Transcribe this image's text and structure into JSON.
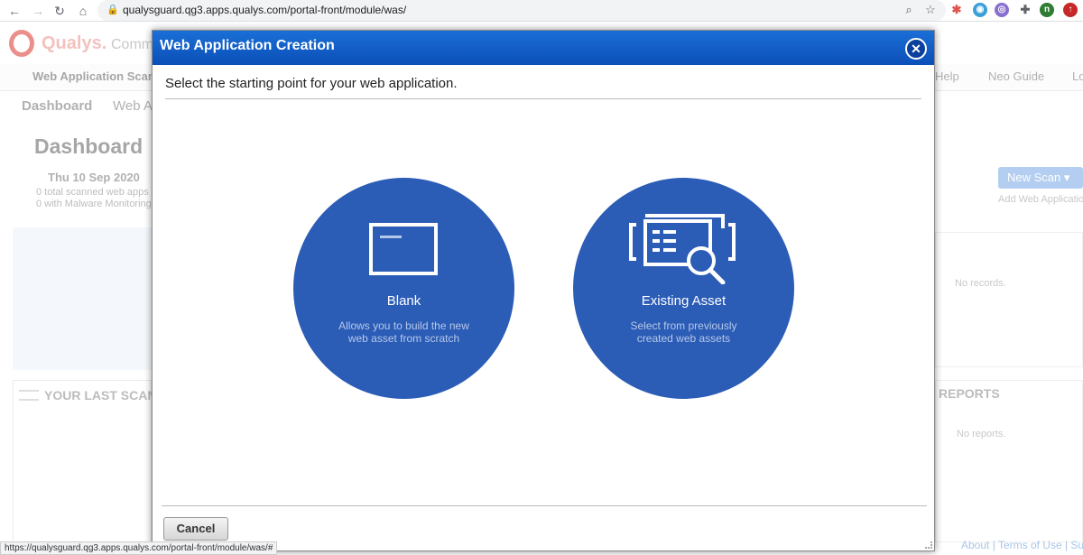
{
  "browser": {
    "url": "qualysguard.qg3.apps.qualys.com/portal-front/module/was/",
    "status_url": "https://qualysguard.qg3.apps.qualys.com/portal-front/module/was/#",
    "profile_initial": "n"
  },
  "background": {
    "logo_text": "Qualys.",
    "logo_sub": "Comm",
    "top_nav": [
      "Web Application Scan",
      "Help",
      "Neo Guide",
      "Lo"
    ],
    "sub_nav": [
      "Dashboard",
      "Web A"
    ],
    "title": "Dashboard",
    "date": "Thu 10 Sep 2020",
    "stats": [
      "0 total scanned web apps",
      "0 with Malware Monitoring"
    ],
    "scans_panel_title": "YOUR LAST SCANS",
    "new_scan_label": "New Scan",
    "add_web_label": "Add Web Application",
    "no_records": "No records.",
    "reports_title": "REPORTS",
    "no_reports": "No reports.",
    "footer": [
      "About",
      "Terms of Use",
      "Su"
    ]
  },
  "modal": {
    "title": "Web Application Creation",
    "prompt": "Select the starting point for your web application.",
    "options": [
      {
        "label": "Blank",
        "description": [
          "Allows you to build the new",
          "web asset from scratch"
        ]
      },
      {
        "label": "Existing Asset",
        "description": [
          "Select from previously",
          "created web assets"
        ]
      }
    ],
    "cancel_label": "Cancel"
  },
  "colors": {
    "header_blue": "#0b4fb8",
    "option_blue": "#2b5cb6",
    "brand_red": "#e0534d"
  },
  "icons": [
    "back-icon",
    "forward-icon",
    "reload-icon",
    "home-icon",
    "lock-icon",
    "zoom-icon",
    "star-icon",
    "close-icon",
    "blank-page-icon",
    "asset-search-icon"
  ]
}
